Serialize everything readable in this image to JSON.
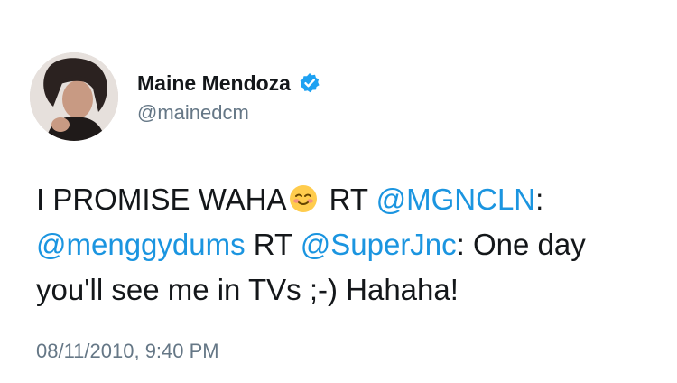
{
  "user": {
    "display_name": "Maine Mendoza",
    "handle": "@mainedcm",
    "verified": true,
    "avatar_icon": "profile-photo"
  },
  "tweet": {
    "part1": "I PROMISE WAHA",
    "emoji_icon": "smiling-face-with-blush-emoji",
    "part2": " RT ",
    "mention1": "@MGNCLN",
    "part3": ": ",
    "mention2": "@menggydums",
    "part4": " RT ",
    "mention3": "@SuperJnc",
    "part5": ": One day you'll see me in TVs ;-) Hahaha!",
    "timestamp": "08/11/2010, 9:40 PM"
  },
  "colors": {
    "link": "#1b95e0",
    "verified_badge": "#1da1f2",
    "secondary_text": "#657786"
  }
}
